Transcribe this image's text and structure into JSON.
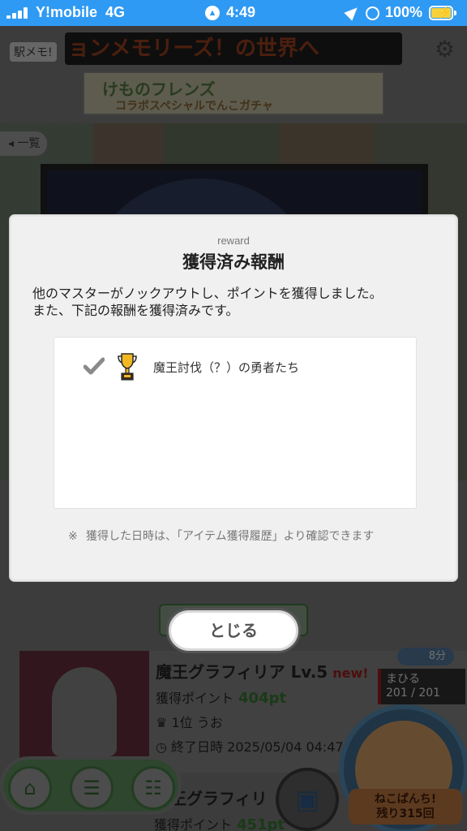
{
  "status_bar": {
    "carrier": "Y!mobile",
    "network": "4G",
    "time": "4:49",
    "battery_percent": "100%",
    "battery_level": 1.0
  },
  "game": {
    "app_label": "駅メモ!",
    "ticker_text": "ョンメモリーズ！の世界へ",
    "banner_title": "けものフレンズ",
    "banner_subtitle": "コラボスペシャルでんこガチャ",
    "list_tab_label": "一覧",
    "boss_card": {
      "name": "魔王グラフィリア  Lv.5",
      "new_tag": "new!",
      "points_label": "獲得ポイント",
      "points_value": "404pt",
      "rank_label": "1位 うお",
      "end_label": "終了日時 2025/05/04 04:47"
    },
    "boss_card_2": {
      "name": "魔王グラフィリ",
      "points_label": "獲得ポイント",
      "points_value": "451pt"
    },
    "time_badge": "8分",
    "user_badge": {
      "name": "まひる",
      "hp": "201 / 201"
    },
    "neko_label": "ねこぱんち!\n残り315回"
  },
  "modal": {
    "subtitle": "reward",
    "title": "獲得済み報酬",
    "description": "他のマスターがノックアウトし、ポイントを獲得しました。\nまた、下記の報酬を獲得済みです。",
    "rewards": [
      {
        "label": "魔王討伐（？）の勇者たち",
        "icon": "trophy-icon",
        "status_icon": "checkmark-icon"
      }
    ],
    "note_mark": "※",
    "note": "獲得した日時は、「アイテム獲得履歴」より確認できます"
  },
  "close_button_label": "とじる",
  "colors": {
    "status_bar": "#2f9af3",
    "modal_bg": "#f0f0f0",
    "points_green": "#3aa33a",
    "new_red": "#c0172a"
  }
}
